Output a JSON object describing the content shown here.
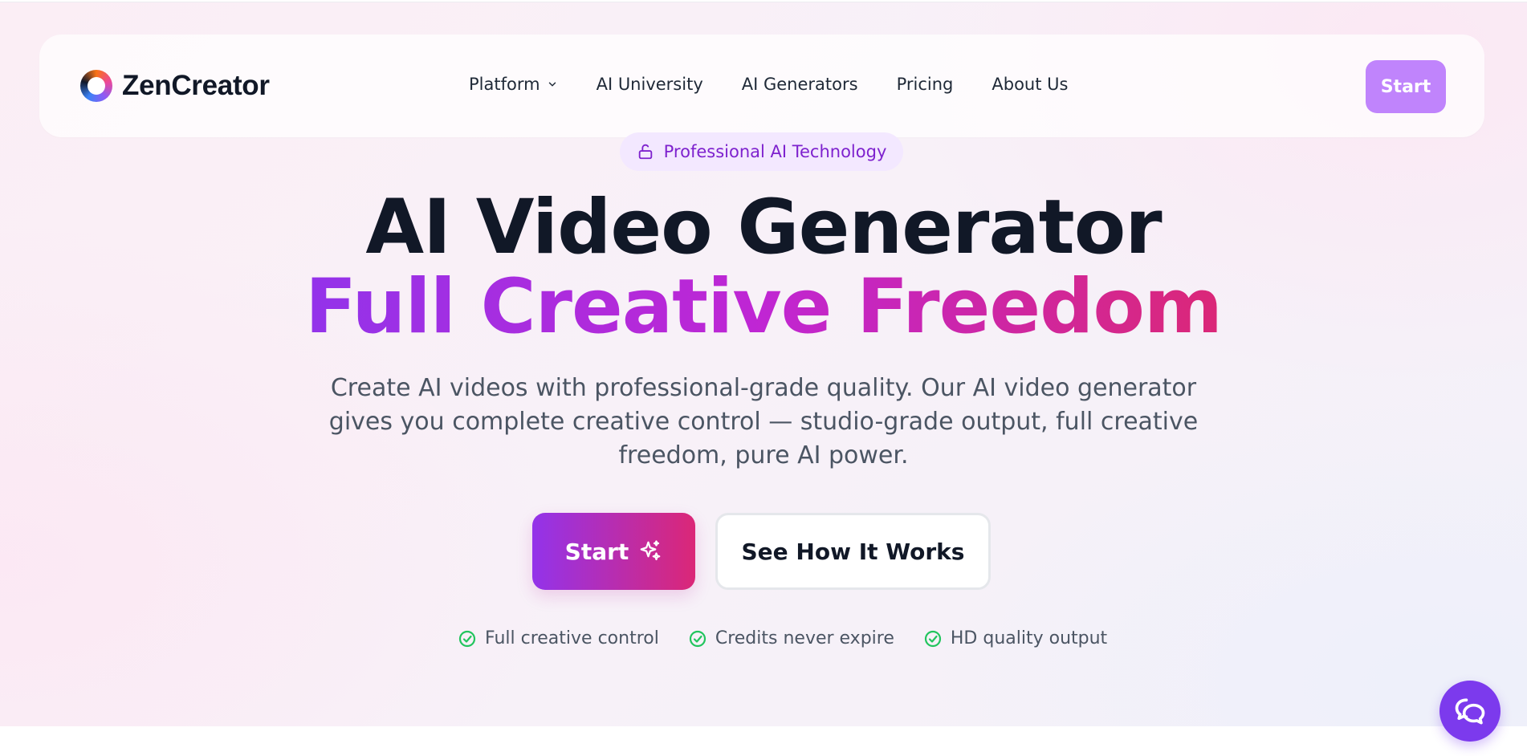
{
  "nav": {
    "brand": "ZenCreator",
    "links": [
      {
        "label": "Platform",
        "has_dropdown": true
      },
      {
        "label": "AI University"
      },
      {
        "label": "AI Generators"
      },
      {
        "label": "Pricing"
      },
      {
        "label": "About Us"
      }
    ],
    "start_label": "Start"
  },
  "hero": {
    "badge": "Professional AI Technology",
    "title_line1": "AI Video Generator",
    "title_line2": "Full Creative Freedom",
    "description": "Create AI videos with professional-grade quality. Our AI video generator gives you complete creative control — studio-grade output, full creative freedom, pure AI power.",
    "cta_primary": "Start",
    "cta_secondary": "See How It Works",
    "features": [
      "Full creative control",
      "Credits never expire",
      "HD quality output"
    ]
  },
  "icons": {
    "badge": "unlock-icon",
    "cta_primary": "sparkles-icon",
    "features": "check-circle-icon",
    "chat": "chat-bubble-icon"
  },
  "colors": {
    "accent_purple": "#9333ea",
    "accent_pink": "#db2777",
    "nav_start_bg": "#c084fc",
    "badge_bg": "#f3e8ff",
    "badge_text": "#7e22ce",
    "check_green": "#22c55e",
    "chat_bg": "#7c3aed"
  }
}
